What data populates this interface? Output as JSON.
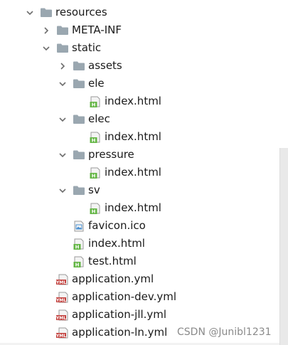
{
  "tree": {
    "items": [
      {
        "label": "resources",
        "depth": 0,
        "expanded": true,
        "kind": "folder"
      },
      {
        "label": "META-INF",
        "depth": 1,
        "expanded": false,
        "kind": "folder"
      },
      {
        "label": "static",
        "depth": 1,
        "expanded": true,
        "kind": "folder"
      },
      {
        "label": "assets",
        "depth": 2,
        "expanded": false,
        "kind": "folder"
      },
      {
        "label": "ele",
        "depth": 2,
        "expanded": true,
        "kind": "folder"
      },
      {
        "label": "index.html",
        "depth": 3,
        "kind": "html"
      },
      {
        "label": "elec",
        "depth": 2,
        "expanded": true,
        "kind": "folder"
      },
      {
        "label": "index.html",
        "depth": 3,
        "kind": "html"
      },
      {
        "label": "pressure",
        "depth": 2,
        "expanded": true,
        "kind": "folder"
      },
      {
        "label": "index.html",
        "depth": 3,
        "kind": "html"
      },
      {
        "label": "sv",
        "depth": 2,
        "expanded": true,
        "kind": "folder"
      },
      {
        "label": "index.html",
        "depth": 3,
        "kind": "html"
      },
      {
        "label": "favicon.ico",
        "depth": 2,
        "kind": "ico"
      },
      {
        "label": "index.html",
        "depth": 2,
        "kind": "html"
      },
      {
        "label": "test.html",
        "depth": 2,
        "kind": "html"
      },
      {
        "label": "application.yml",
        "depth": 1,
        "kind": "yml"
      },
      {
        "label": "application-dev.yml",
        "depth": 1,
        "kind": "yml"
      },
      {
        "label": "application-jll.yml",
        "depth": 1,
        "kind": "yml"
      },
      {
        "label": "application-ln.yml",
        "depth": 1,
        "kind": "yml"
      }
    ]
  },
  "icons": {
    "folder": "folder-icon",
    "html": "html-file-icon",
    "ico": "image-file-icon",
    "yml": "yml-file-icon",
    "expanded": "chevron-down-icon",
    "collapsed": "chevron-right-icon"
  },
  "colors": {
    "folder": "#9aa7b0",
    "html_badge": "#62b543",
    "yml_badge": "#c3423f",
    "ico_accent": "#4a8fd1"
  },
  "watermark": "CSDN @Junibl1231"
}
